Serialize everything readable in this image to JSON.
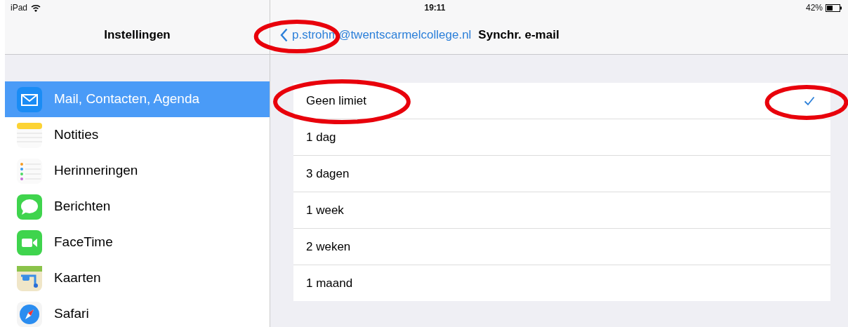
{
  "status_bar": {
    "device": "iPad",
    "time": "19:11",
    "battery": "42%"
  },
  "sidebar": {
    "title": "Instellingen",
    "items": [
      {
        "label": "Mail, Contacten, Agenda",
        "selected": true
      },
      {
        "label": "Notities",
        "selected": false
      },
      {
        "label": "Herinneringen",
        "selected": false
      },
      {
        "label": "Berichten",
        "selected": false
      },
      {
        "label": "FaceTime",
        "selected": false
      },
      {
        "label": "Kaarten",
        "selected": false
      },
      {
        "label": "Safari",
        "selected": false
      }
    ]
  },
  "detail": {
    "back": {
      "label": "p.strohm@twentscarmelcollege.nl",
      "circled": true
    },
    "title": "Synchr. e-mail",
    "options": [
      {
        "label": "Geen limiet",
        "selected": true,
        "circled": true,
        "check_circled": true
      },
      {
        "label": "1 dag",
        "selected": false,
        "circled": false,
        "check_circled": false
      },
      {
        "label": "3 dagen",
        "selected": false,
        "circled": false,
        "check_circled": false
      },
      {
        "label": "1 week",
        "selected": false,
        "circled": false,
        "check_circled": false
      },
      {
        "label": "2 weken",
        "selected": false,
        "circled": false,
        "check_circled": false
      },
      {
        "label": "1 maand",
        "selected": false,
        "circled": false,
        "check_circled": false
      }
    ]
  }
}
